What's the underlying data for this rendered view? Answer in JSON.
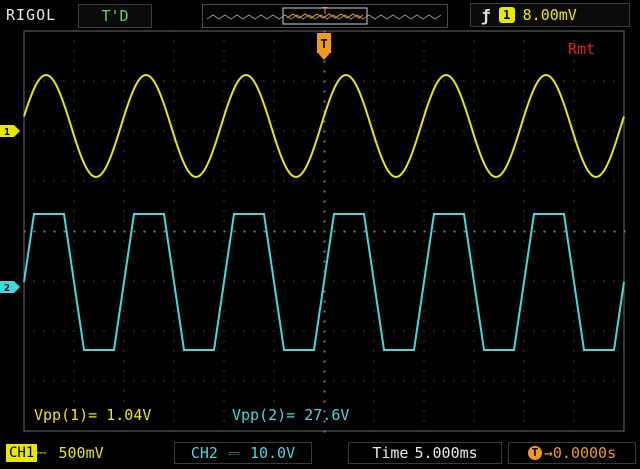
{
  "header": {
    "brand": "RIGOL",
    "trigger_state": "T'D",
    "trigger_edge_icon": "rising-edge-icon",
    "trigger_source": "1",
    "trigger_level": "8.00mV",
    "trigger_marker": "T"
  },
  "screen": {
    "remote_indicator": "Rmt",
    "ch1_marker": "1",
    "ch2_marker": "2",
    "measurements": [
      {
        "label": "Vpp(1)= 1.04V"
      },
      {
        "label": "Vpp(2)= 27.6V"
      }
    ]
  },
  "footer": {
    "ch1_label": "CH1",
    "ch1_scale": "500mV",
    "ch2_label": "CH2",
    "ch2_scale": "10.0V",
    "time_label": "Time",
    "time_base": "5.000ms",
    "trigger_offset": "→0.0000s"
  },
  "colors": {
    "ch1": "#e8e800",
    "ch2": "#3fd9e0",
    "trigger": "#f39a1c",
    "remote": "#e31b1b"
  }
}
